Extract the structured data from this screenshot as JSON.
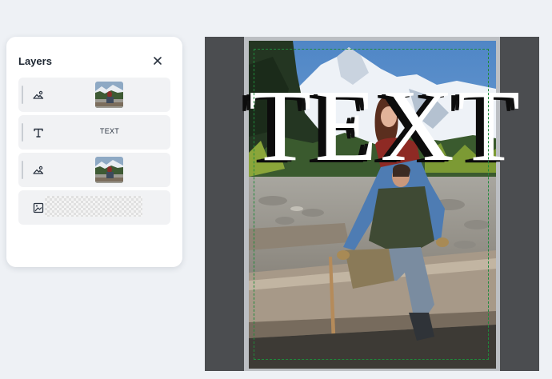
{
  "layers_panel": {
    "title": "Layers",
    "close_icon": "close-icon",
    "layers": [
      {
        "type": "image",
        "icon": "image-layer-icon",
        "preview": "photo-thumbnail"
      },
      {
        "type": "text",
        "icon": "text-layer-icon",
        "label": "TEXT"
      },
      {
        "type": "image",
        "icon": "image-layer-icon",
        "preview": "photo-thumbnail"
      },
      {
        "type": "background",
        "icon": "background-layer-icon",
        "preview": "transparent-checkerboard"
      }
    ]
  },
  "canvas": {
    "overlay_text": "TEXT",
    "background_color": "#4b4d50",
    "guide_color": "#1f8a3b"
  }
}
